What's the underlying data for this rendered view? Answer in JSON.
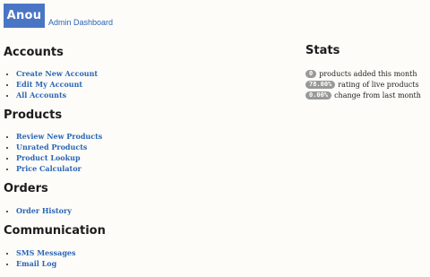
{
  "header": {
    "logo_text": "Anou",
    "admin_link": "Admin Dashboard"
  },
  "sections": {
    "accounts": {
      "title": "Accounts",
      "items": [
        "Create New Account",
        "Edit My Account",
        "All Accounts"
      ]
    },
    "products": {
      "title": "Products",
      "items": [
        "Review New Products",
        "Unrated Products",
        "Product Lookup",
        "Price Calculator"
      ]
    },
    "orders": {
      "title": "Orders",
      "items": [
        "Order History"
      ]
    },
    "communication": {
      "title": "Communication",
      "items": [
        "SMS Messages",
        "Email Log"
      ]
    }
  },
  "stats": {
    "title": "Stats",
    "rows": [
      {
        "value": "0",
        "label": "products added this month"
      },
      {
        "value": "78.00%",
        "label": "rating of live products"
      },
      {
        "value": "0.00%",
        "label": "change from last month"
      }
    ]
  },
  "colors": {
    "logo_bg": "#4a75c4",
    "link": "#2a66b7",
    "badge": "#999999"
  }
}
